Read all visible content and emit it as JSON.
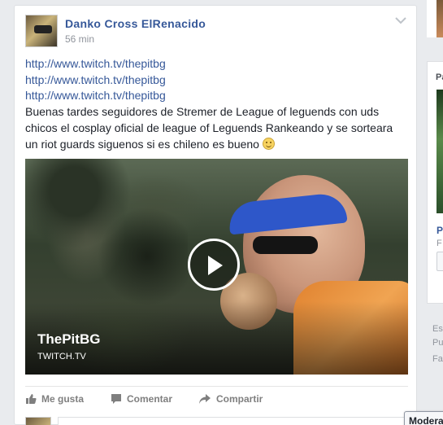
{
  "post": {
    "author": "Danko Cross ElRenacido",
    "timestamp": "56 min",
    "links": [
      "http://www.twitch.tv/thepitbg",
      "http://www.twitch.tv/thepitbg",
      "http://www.twitch.tv/thepitbg"
    ],
    "message": "Buenas tardes seguidores de Stremer de League of leguends con uds chicos el cosplay oficial de league of Leguends Rankeando y se sorteara un riot guards siguenos si es chileno es bueno",
    "emoticon": "smile-emoji",
    "media": {
      "title": "ThePitBG",
      "source": "TWITCH.TV",
      "play_icon": "play-icon"
    },
    "actions": {
      "like": "Me gusta",
      "comment": "Comentar",
      "share": "Compartir"
    }
  },
  "right_column": {
    "panel_label": "Pa",
    "panel_title": "P",
    "panel_sub": "F",
    "footer": [
      "Es",
      "Pu",
      "Fa"
    ]
  },
  "chat_tab": {
    "label": "Modera"
  },
  "colors": {
    "link": "#365899",
    "background": "#e9ebee",
    "text": "#1d2129",
    "muted": "#90949c"
  }
}
